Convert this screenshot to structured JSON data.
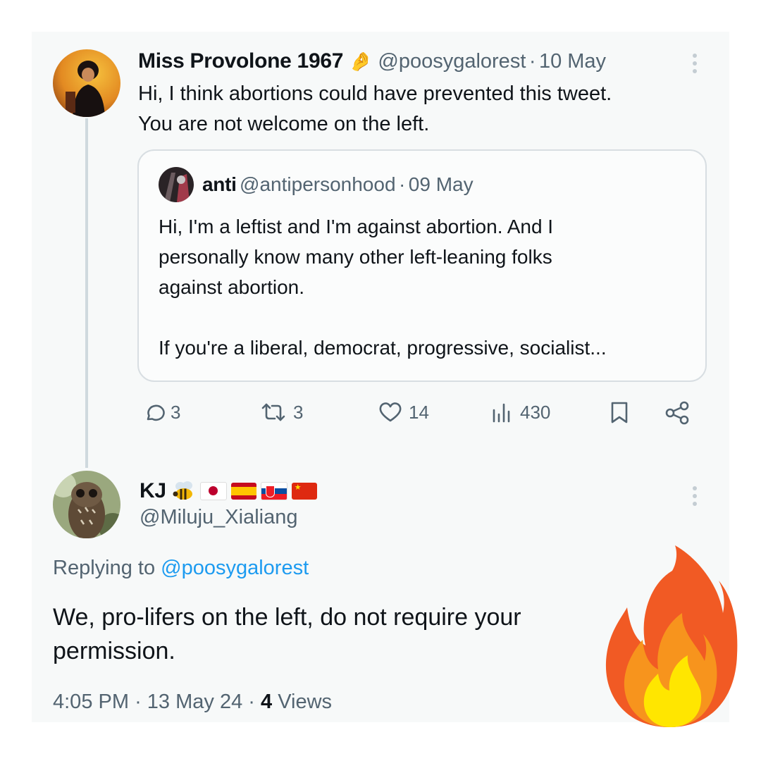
{
  "tweet1": {
    "display_name": "Miss Provolone 1967",
    "badge_emoji": "🤌",
    "handle": "@poosygalorest",
    "date": "10 May",
    "text_line1": "Hi, I think abortions could have prevented this tweet.",
    "text_line2": "You are not welcome on the left."
  },
  "quote": {
    "display_name": "anti",
    "handle": "@antipersonhood",
    "date": "09 May",
    "line1": "Hi, I'm a leftist and I'm against abortion. And I",
    "line2": "personally know many other left-leaning folks",
    "line3": "against abortion.",
    "line4": "If you're a liberal, democrat, progressive, socialist..."
  },
  "actions": {
    "replies": "3",
    "reposts": "3",
    "likes": "14",
    "views": "430"
  },
  "tweet2": {
    "display_name": "KJ",
    "handle": "@Miluju_Xialiang",
    "replying_label": "Replying to",
    "replying_handle": "@poosygalorest",
    "text_line1": "We, pro-lifers on the left, do not require your",
    "text_line2": "permission.",
    "time": "4:05 PM",
    "date": "13 May 24",
    "views_count": "4",
    "views_label": "Views"
  },
  "icons": {
    "reply": "reply-icon",
    "repost": "repost-icon",
    "like": "heart-icon",
    "views": "views-icon",
    "bookmark": "bookmark-icon",
    "share": "share-icon",
    "more": "more-icon",
    "fire": "fire-icon",
    "bee": "bee-icon",
    "flags": [
      "japan-flag-icon",
      "spain-flag-icon",
      "slovakia-flag-icon",
      "china-flag-icon"
    ]
  },
  "colors": {
    "text": "#0f1419",
    "muted": "#536471",
    "link": "#1d9bf0",
    "border": "#d8dee2",
    "thread": "#cfd9de"
  }
}
